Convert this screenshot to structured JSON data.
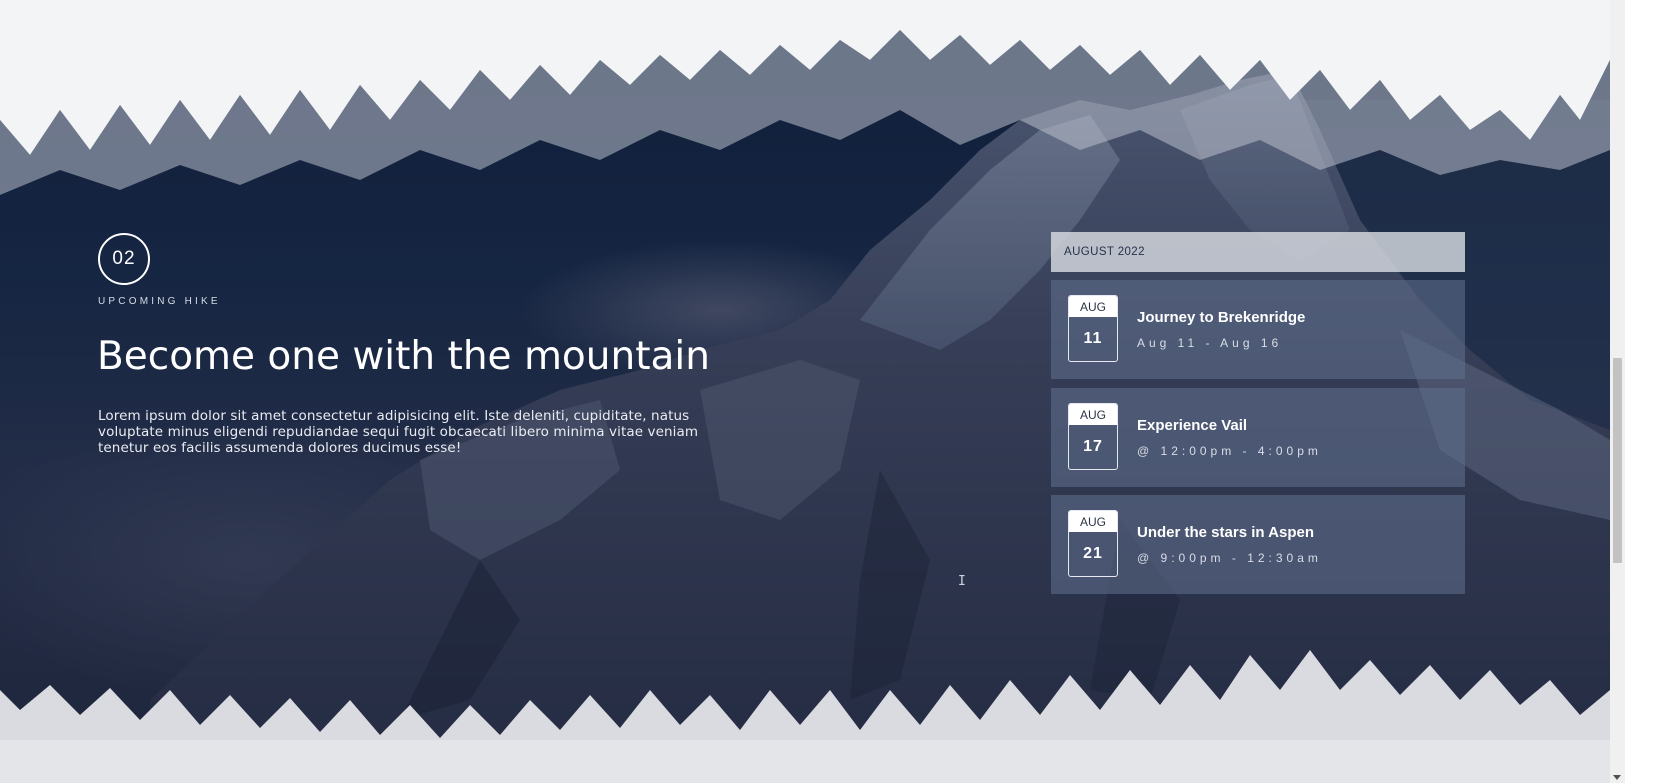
{
  "hero": {
    "number": "02",
    "eyebrow": "UPCOMING HIKE",
    "title": "Become one with the mountain",
    "description": "Lorem ipsum dolor sit amet consectetur adipisicing elit. Iste deleniti, cupiditate, natus voluptate minus eligendi repudiandae sequi fugit obcaecati libero minima vitae veniam tenetur eos facilis assumenda dolores ducimus esse!"
  },
  "events": {
    "month_label": "AUGUST 2022",
    "items": [
      {
        "month": "AUG",
        "day": "11",
        "title": "Journey to Brekenridge",
        "time": "Aug 11 - Aug 16"
      },
      {
        "month": "AUG",
        "day": "17",
        "title": "Experience Vail",
        "time": "@ 12:00pm - 4:00pm"
      },
      {
        "month": "AUG",
        "day": "21",
        "title": "Under the stars in Aspen",
        "time": "@ 9:00pm - 12:30am"
      }
    ]
  },
  "colors": {
    "overlay_navy": "#0f1e38",
    "panel_header": "#d7dae1",
    "card_bg": "#5f6f8c",
    "text": "#ffffff"
  },
  "icons": {
    "cursor": "text-cursor-icon"
  }
}
